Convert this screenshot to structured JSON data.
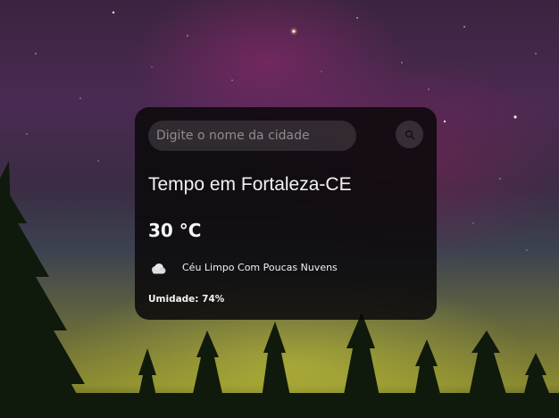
{
  "search": {
    "placeholder": "Digite o nome da cidade",
    "value": "",
    "button_icon": "search-icon"
  },
  "weather": {
    "title": "Tempo em Fortaleza-CE",
    "temperature": "30 °C",
    "icon": "partly-cloudy-icon",
    "description": "Céu Limpo Com Poucas Nuvens",
    "humidity": "Umidade: 74%"
  },
  "colors": {
    "card_background": "#0a080a",
    "text": "#ffffff",
    "input_background": "#4a444a",
    "placeholder": "#8f8a90"
  }
}
